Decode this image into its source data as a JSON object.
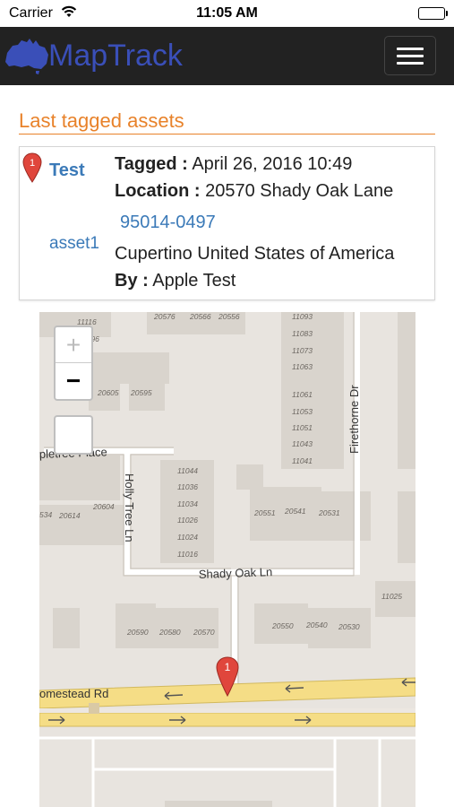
{
  "status_bar": {
    "carrier": "Carrier",
    "time": "11:05 AM"
  },
  "navbar": {
    "brand": "MapTrack",
    "menu_icon": "hamburger-icon"
  },
  "section": {
    "title": "Last tagged assets"
  },
  "asset": {
    "marker_number": "1",
    "name": "Test",
    "id": "asset1",
    "tagged_label": "Tagged :",
    "tagged_value": "April 26, 2016 10:49",
    "location_label": "Location :",
    "location_street": "20570 Shady Oak Lane",
    "location_zip": "95014-0497",
    "location_city": "Cupertino United States of America",
    "by_label": "By :",
    "by_value": "Apple Test"
  },
  "map": {
    "zoom_in": "+",
    "zoom_out": "−",
    "marker_number": "1",
    "streets": {
      "firethorne": "Firethorne Dr",
      "holly_tree": "Holly Tree Ln",
      "appletree": "pletree Place",
      "shady_oak": "Shady Oak Ln",
      "homestead": "omestead Rd"
    },
    "parcels": {
      "r1": [
        "11116",
        "1096",
        "20576",
        "20566",
        "20556",
        "11093",
        "11083",
        "11073",
        "11063",
        "11061",
        "11053",
        "11051",
        "11043",
        "11041"
      ],
      "r2": [
        "20605",
        "20595",
        "11044",
        "11036",
        "11034",
        "11026",
        "11024",
        "11016",
        "534",
        "20614",
        "20604",
        "20551",
        "20541",
        "20531",
        "11025"
      ],
      "r3": [
        "20590",
        "20580",
        "20570",
        "20550",
        "20540",
        "20530"
      ]
    }
  }
}
